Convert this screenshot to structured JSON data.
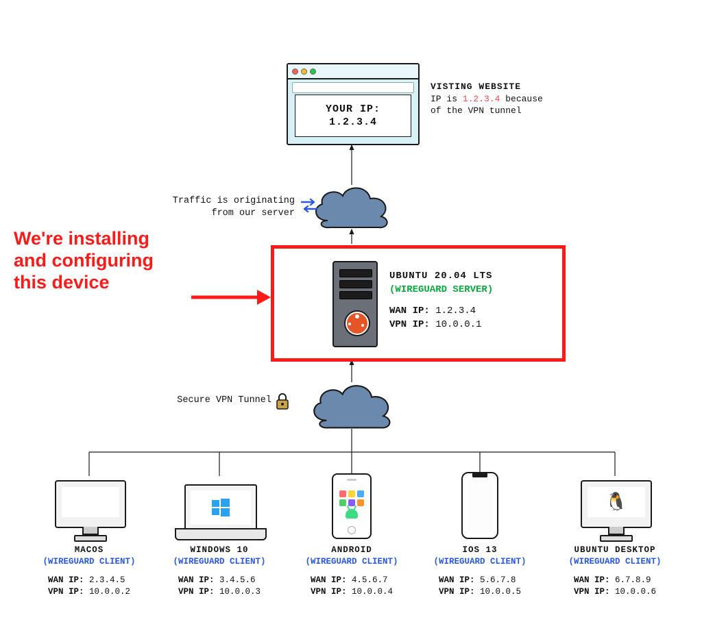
{
  "browser": {
    "line1": "YOUR IP:",
    "line2": "1.2.3.4"
  },
  "website_caption": {
    "heading": "VISTING WEBSITE",
    "prefix": "IP is ",
    "ip": "1.2.3.4",
    "suffix1": " because",
    "suffix2": "of the VPN tunnel"
  },
  "traffic_caption_l1": "Traffic is originating",
  "traffic_caption_l2": "from our server",
  "callout_l1": "We're installing",
  "callout_l2": "and configuring",
  "callout_l3": "this device",
  "server": {
    "os": "UBUNTU 20.04 LTS",
    "role": "(WIREGUARD SERVER)",
    "wan_k": "WAN IP:",
    "wan_v": "1.2.3.4",
    "vpn_k": "VPN IP:",
    "vpn_v": "10.0.0.1"
  },
  "tunnel_label": "Secure VPN Tunnel",
  "client_role": "(WIREGUARD CLIENT)",
  "wan_k": "WAN IP:",
  "vpn_k": "VPN IP:",
  "clients": [
    {
      "os": "MACOS",
      "wan": "2.3.4.5",
      "vpn": "10.0.0.2"
    },
    {
      "os": "WINDOWS 10",
      "wan": "3.4.5.6",
      "vpn": "10.0.0.3"
    },
    {
      "os": "ANDROID",
      "wan": "4.5.6.7",
      "vpn": "10.0.0.4"
    },
    {
      "os": "IOS 13",
      "wan": "5.6.7.8",
      "vpn": "10.0.0.5"
    },
    {
      "os": "UBUNTU DESKTOP",
      "wan": "6.7.8.9",
      "vpn": "10.0.0.6"
    }
  ]
}
